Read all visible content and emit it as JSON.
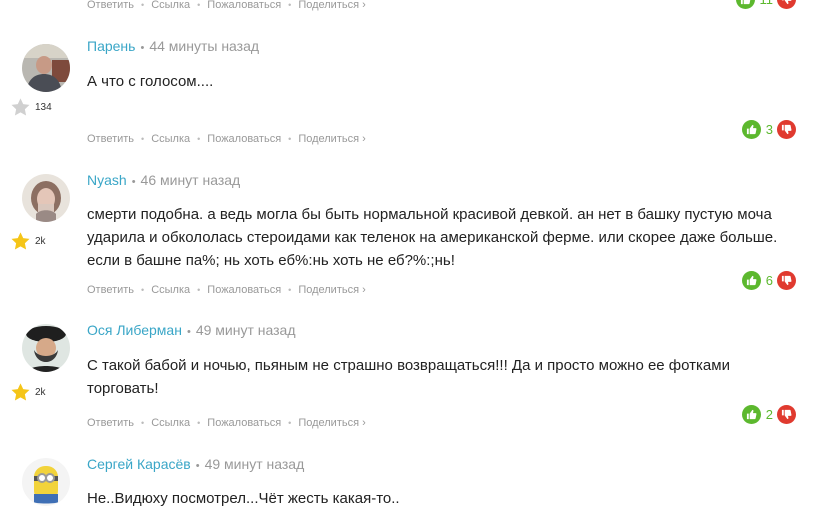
{
  "actions": {
    "reply": "Ответить",
    "link": "Ссылка",
    "report": "Пожаловаться",
    "share": "Поделиться"
  },
  "top_votes": {
    "count": "11"
  },
  "comments": [
    {
      "author": "Парень",
      "time": "44 минуты назад",
      "text": "А что с голосом....",
      "rating": "134",
      "star": "grey",
      "votes": "3"
    },
    {
      "author": "Nyash",
      "time": "46 минут назад",
      "text": "смерти подобна. а ведь могла бы быть нормальной красивой девкой. ан нет в башку пустую моча ударила и обкололась стероидами как теленок на американской ферме. или скорее даже больше. если в башне па%; нь хоть еб%:нь хоть не еб?%:;нь!",
      "rating": "2k",
      "star": "gold",
      "votes": "6"
    },
    {
      "author": "Ося Либерман",
      "time": "49 минут назад",
      "text": "С такой бабой и ночью, пьяным не страшно возвращаться!!! Да и просто можно ее фотками торговать!",
      "rating": "2k",
      "star": "gold",
      "votes": "2"
    },
    {
      "author": "Сергей Карасёв",
      "time": "49 минут назад",
      "text": "Не..Видюху посмотрел...Чёт жесть какая-то..",
      "rating": "",
      "star": "",
      "votes": ""
    }
  ],
  "colors": {
    "author": "#3aa6c7",
    "vote_up": "#5cb82e",
    "vote_down": "#e03a2f",
    "star_gold": "#f5c518",
    "star_grey": "#d0d0d0"
  }
}
